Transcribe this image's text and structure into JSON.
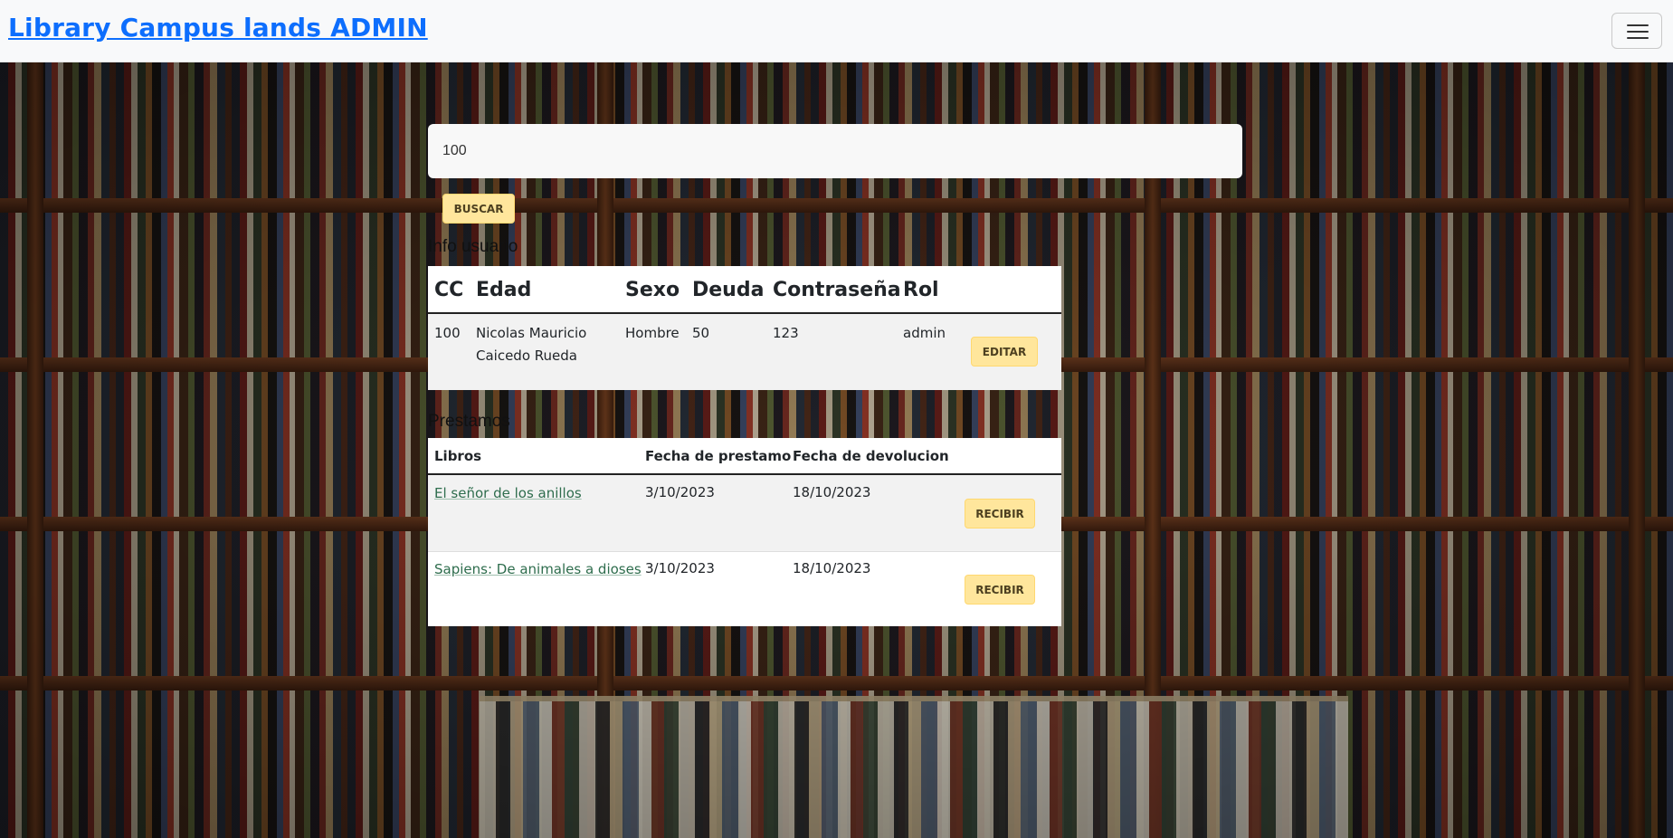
{
  "navbar": {
    "brand": "Library Campus lands ADMIN",
    "toggle_icon": "hamburger-menu-icon"
  },
  "search": {
    "value": "100",
    "button_label": "BUSCAR"
  },
  "user_section": {
    "title": "Info usuario",
    "headers": [
      "CC",
      "Edad",
      "Sexo",
      "Deuda",
      "Contraseña",
      "Rol"
    ],
    "row": {
      "cc": "100",
      "name": "Nicolas Mauricio Caicedo Rueda",
      "sexo": "Hombre",
      "deuda": "50",
      "password": "123",
      "rol": "admin",
      "edit_label": "EDITAR"
    }
  },
  "loans_section": {
    "title": "Prestamos",
    "headers": [
      "Libros",
      "Fecha de prestamo",
      "Fecha de devolucion"
    ],
    "rows": [
      {
        "book": "El señor de los anillos",
        "loan_date": "3/10/2023",
        "return_date": "18/10/2023",
        "action": "RECIBIR"
      },
      {
        "book": "Sapiens: De animales a dioses",
        "loan_date": "3/10/2023",
        "return_date": "18/10/2023",
        "action": "RECIBIR"
      }
    ]
  },
  "colors": {
    "brand": "#0d6efd",
    "warning_button": "#ffe69c",
    "link": "#2e6d4d",
    "navbar_bg": "#f8f9fa"
  }
}
